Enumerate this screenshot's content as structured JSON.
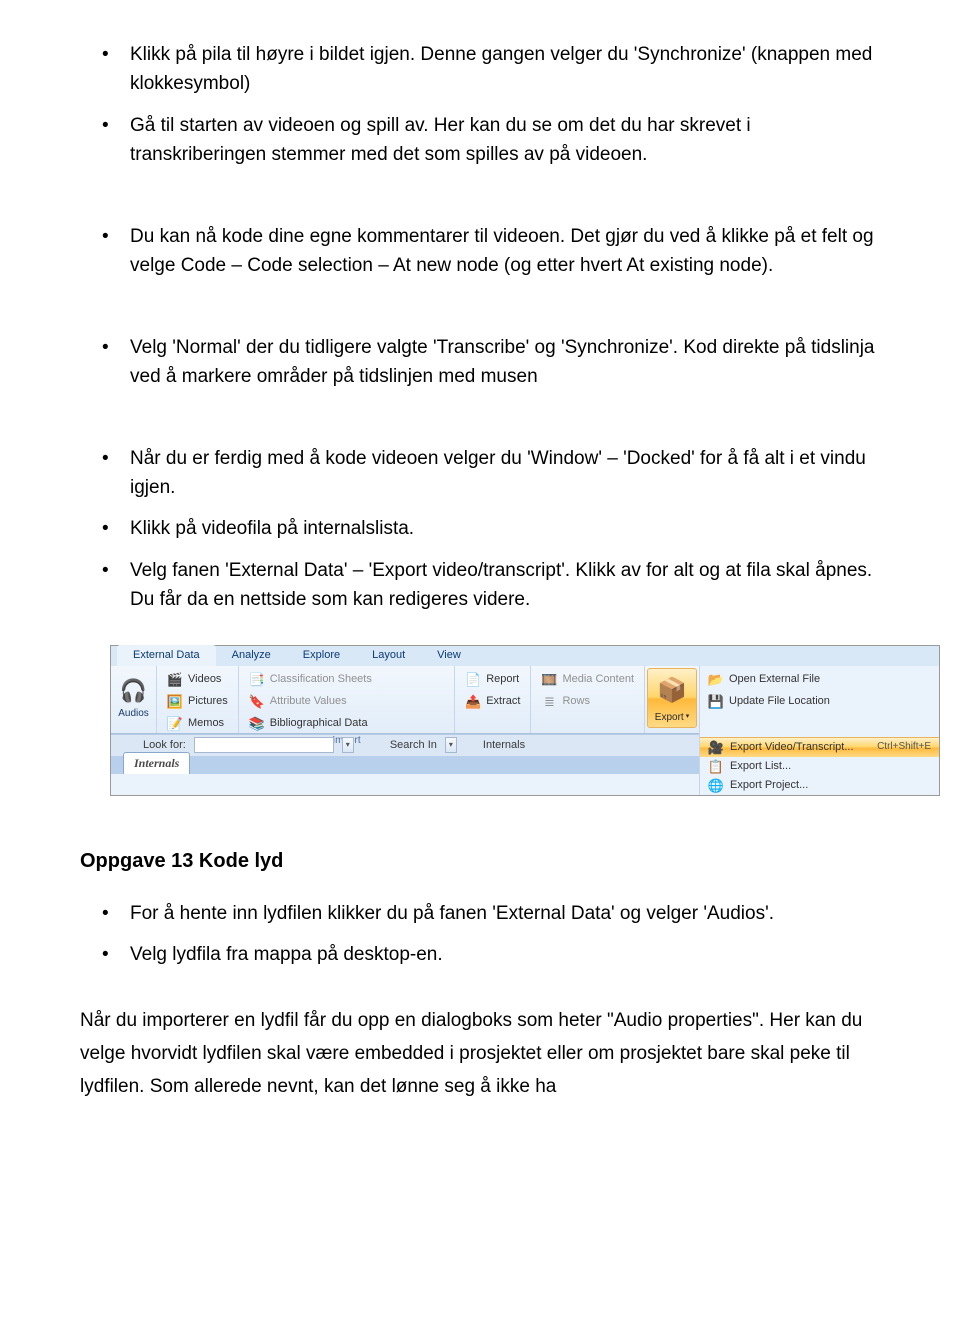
{
  "bullets_top": [
    "Klikk på pila til høyre i bildet igjen. Denne gangen velger du 'Synchronize' (knappen med klokkesymbol)",
    "Gå til starten av videoen og spill av. Her kan du se om det du har skrevet i transkriberingen stemmer med det som spilles av på videoen."
  ],
  "bullets_mid1": [
    "Du kan nå kode dine egne kommentarer til videoen. Det gjør du ved å klikke på et felt og velge Code – Code selection – At new node (og etter hvert At existing node)."
  ],
  "bullets_mid2": [
    "Velg 'Normal' der du tidligere valgte 'Transcribe' og 'Synchronize'. Kod direkte på tidslinja ved å markere områder på tidslinjen med musen"
  ],
  "bullets_mid3": [
    "Når du er ferdig med å kode videoen velger du 'Window' – 'Docked' for å få alt i et vindu igjen.",
    "Klikk på videofila på internalslista.",
    "Velg fanen 'External Data' – 'Export video/transcript'. Klikk av for alt og at fila skal åpnes. Du får da en nettside som kan redigeres videre."
  ],
  "heading13": "Oppgave 13 Kode lyd",
  "bullets_13": [
    "For å hente inn lydfilen klikker du på fanen 'External Data' og velger 'Audios'.",
    "Velg lydfila fra mappa på desktop-en."
  ],
  "para_bottom": "Når du importerer en lydfil får du opp en dialogboks som heter \"Audio properties\". Her kan du velge hvorvidt lydfilen skal være embedded i prosjektet eller om prosjektet bare skal peke til lydfilen. Som allerede nevnt, kan det lønne seg å ikke ha",
  "ribbon": {
    "tabs": [
      "External Data",
      "Analyze",
      "Explore",
      "Layout",
      "View"
    ],
    "audios_label": "Audios",
    "import_caption": "Import",
    "import_rows1": [
      "Videos",
      "Pictures",
      "Memos"
    ],
    "import_rows2": [
      "Classification Sheets",
      "Attribute Values",
      "Bibliographical Data"
    ],
    "report_col": [
      "Report",
      "Extract"
    ],
    "media_col": [
      "Media Content",
      "Rows"
    ],
    "export_label": "Export",
    "open_rows": [
      "Open External File",
      "Update File Location"
    ],
    "dd1": {
      "label": "Export Video/Transcript...",
      "shortcut": "Ctrl+Shift+E"
    },
    "dd2": "Export List...",
    "dd3": "Export Project...",
    "lookfor": "Look for:",
    "searchin": "Search In",
    "internals": "Internals",
    "internals_tab": "Internals"
  }
}
